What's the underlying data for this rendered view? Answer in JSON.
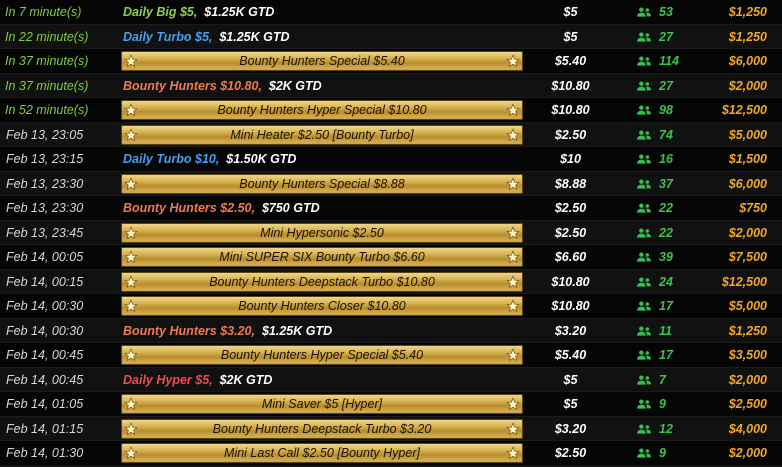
{
  "colors": {
    "time_soon": "#7ed13a",
    "time": "#d8d8d8",
    "buyin": "#ffffff",
    "players": "#3ec24a",
    "guarantee": "#f2a823",
    "daily_big": "#8fd14a",
    "daily_turbo": "#4a9ff0",
    "bounty_hunters": "#f07a4e",
    "daily_hyper": "#ef4c4c",
    "banner_gold": "#d8b454"
  },
  "rows": [
    {
      "time": "In 7 minute(s)",
      "soon": true,
      "kind": "text",
      "name": "Daily Big $5,",
      "gtd_label": "$1.25K GTD",
      "name_color": "#8fd14a",
      "buyin": "$5",
      "players": "53",
      "guarantee": "$1,250"
    },
    {
      "time": "In 22 minute(s)",
      "soon": true,
      "kind": "text",
      "name": "Daily Turbo $5,",
      "gtd_label": "$1.25K GTD",
      "name_color": "#4a9ff0",
      "buyin": "$5",
      "players": "27",
      "guarantee": "$1,250"
    },
    {
      "time": "In 37 minute(s)",
      "soon": true,
      "kind": "banner",
      "name": "Bounty Hunters Special $5.40",
      "buyin": "$5.40",
      "players": "114",
      "guarantee": "$6,000"
    },
    {
      "time": "In 37 minute(s)",
      "soon": true,
      "kind": "text",
      "name": "Bounty Hunters $10.80,",
      "gtd_label": "$2K GTD",
      "name_color": "#f07a4e",
      "buyin": "$10.80",
      "players": "27",
      "guarantee": "$2,000"
    },
    {
      "time": "In 52 minute(s)",
      "soon": true,
      "kind": "banner",
      "name": "Bounty Hunters Hyper Special $10.80",
      "buyin": "$10.80",
      "players": "98",
      "guarantee": "$12,500"
    },
    {
      "time": "Feb 13, 23:05",
      "soon": false,
      "kind": "banner",
      "name": "Mini Heater $2.50 [Bounty Turbo]",
      "buyin": "$2.50",
      "players": "74",
      "guarantee": "$5,000"
    },
    {
      "time": "Feb 13, 23:15",
      "soon": false,
      "kind": "text",
      "name": "Daily Turbo $10,",
      "gtd_label": "$1.50K GTD",
      "name_color": "#4a9ff0",
      "buyin": "$10",
      "players": "16",
      "guarantee": "$1,500"
    },
    {
      "time": "Feb 13, 23:30",
      "soon": false,
      "kind": "banner",
      "name": "Bounty Hunters Special $8.88",
      "buyin": "$8.88",
      "players": "37",
      "guarantee": "$6,000"
    },
    {
      "time": "Feb 13, 23:30",
      "soon": false,
      "kind": "text",
      "name": "Bounty Hunters $2.50,",
      "gtd_label": "$750 GTD",
      "name_color": "#f07a4e",
      "buyin": "$2.50",
      "players": "22",
      "guarantee": "$750"
    },
    {
      "time": "Feb 13, 23:45",
      "soon": false,
      "kind": "banner",
      "name": "Mini Hypersonic $2.50",
      "buyin": "$2.50",
      "players": "22",
      "guarantee": "$2,000"
    },
    {
      "time": "Feb 14, 00:05",
      "soon": false,
      "kind": "banner",
      "name": "Mini SUPER SIX Bounty Turbo $6.60",
      "buyin": "$6.60",
      "players": "39",
      "guarantee": "$7,500"
    },
    {
      "time": "Feb 14, 00:15",
      "soon": false,
      "kind": "banner",
      "name": "Bounty Hunters Deepstack Turbo $10.80",
      "buyin": "$10.80",
      "players": "24",
      "guarantee": "$12,500"
    },
    {
      "time": "Feb 14, 00:30",
      "soon": false,
      "kind": "banner",
      "name": "Bounty Hunters Closer $10.80",
      "buyin": "$10.80",
      "players": "17",
      "guarantee": "$5,000"
    },
    {
      "time": "Feb 14, 00:30",
      "soon": false,
      "kind": "text",
      "name": "Bounty Hunters $3.20,",
      "gtd_label": "$1.25K GTD",
      "name_color": "#f07a4e",
      "buyin": "$3.20",
      "players": "11",
      "guarantee": "$1,250"
    },
    {
      "time": "Feb 14, 00:45",
      "soon": false,
      "kind": "banner",
      "name": "Bounty Hunters Hyper Special $5.40",
      "buyin": "$5.40",
      "players": "17",
      "guarantee": "$3,500"
    },
    {
      "time": "Feb 14, 00:45",
      "soon": false,
      "kind": "text",
      "name": "Daily Hyper $5,",
      "gtd_label": "$2K GTD",
      "name_color": "#ef4c4c",
      "buyin": "$5",
      "players": "7",
      "guarantee": "$2,000"
    },
    {
      "time": "Feb 14, 01:05",
      "soon": false,
      "kind": "banner",
      "name": "Mini Saver $5 [Hyper]",
      "buyin": "$5",
      "players": "9",
      "guarantee": "$2,500"
    },
    {
      "time": "Feb 14, 01:15",
      "soon": false,
      "kind": "banner",
      "name": "Bounty Hunters Deepstack Turbo $3.20",
      "buyin": "$3.20",
      "players": "12",
      "guarantee": "$4,000"
    },
    {
      "time": "Feb 14, 01:30",
      "soon": false,
      "kind": "banner",
      "name": "Mini Last Call $2.50 [Bounty Hyper]",
      "buyin": "$2.50",
      "players": "9",
      "guarantee": "$2,000"
    }
  ],
  "icons": {
    "players": "users-icon",
    "banner_star": "star-icon"
  }
}
